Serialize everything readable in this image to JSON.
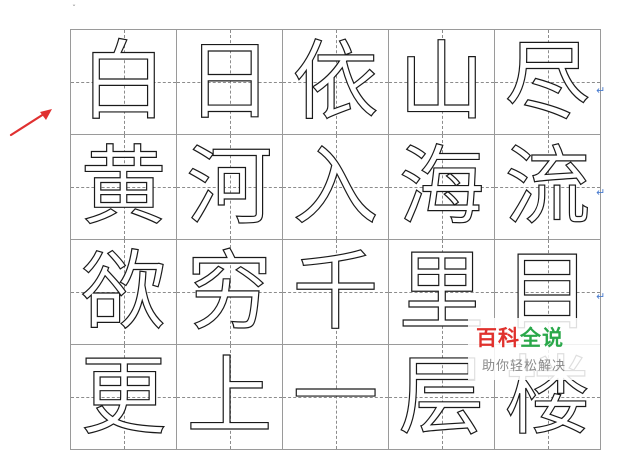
{
  "grid": {
    "rows": [
      [
        "白",
        "日",
        "依",
        "山",
        "尽"
      ],
      [
        "黄",
        "河",
        "入",
        "海",
        "流"
      ],
      [
        "欲",
        "穷",
        "千",
        "里",
        "目"
      ],
      [
        "更",
        "上",
        "一",
        "层",
        "楼"
      ]
    ]
  },
  "paragraph_mark": "↵",
  "watermark": {
    "title_part1": "百科",
    "title_part2": "全说",
    "subtitle": "助你轻松解决",
    "color_part1": "#e0312d",
    "color_part2": "#2aa84a"
  },
  "colors": {
    "arrow": "#e03030",
    "grid_line": "#9a9a9a"
  }
}
